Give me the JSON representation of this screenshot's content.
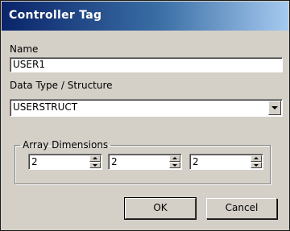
{
  "dialog": {
    "title": "Controller Tag"
  },
  "name_field": {
    "label": "Name",
    "value": "USER1"
  },
  "data_type": {
    "label": "Data Type / Structure",
    "selected": "USERSTRUCT",
    "icon": "chevron-down-icon"
  },
  "array_dimensions": {
    "label": "Array Dimensions",
    "values": [
      "2",
      "2",
      "2"
    ],
    "icons": {
      "up": "spin-up-icon",
      "down": "spin-down-icon"
    }
  },
  "buttons": {
    "ok": "OK",
    "cancel": "Cancel"
  },
  "colors": {
    "title_bar_start": "#0a246a",
    "title_bar_end": "#a6caf0",
    "face": "#d4d0c8"
  }
}
